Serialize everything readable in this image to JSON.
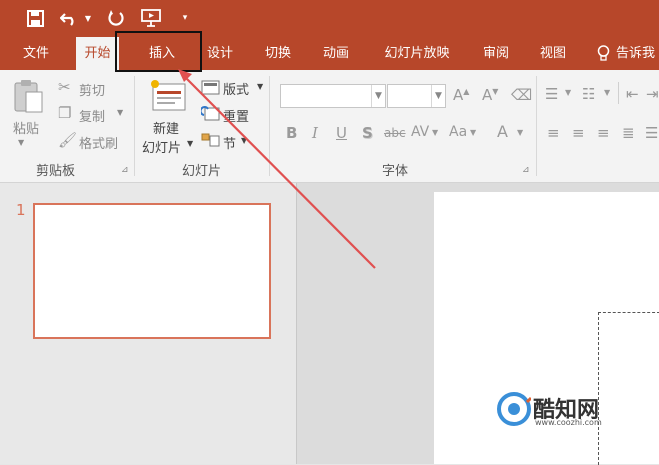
{
  "menu": {
    "tabs": [
      "文件",
      "开始",
      "插入",
      "设计",
      "切换",
      "动画",
      "幻灯片放映",
      "审阅",
      "视图"
    ],
    "tell_me": "告诉我"
  },
  "ribbon": {
    "clipboard": {
      "paste": "粘贴",
      "cut": "剪切",
      "copy": "复制",
      "format_painter": "格式刷",
      "group_label": "剪贴板"
    },
    "slides": {
      "new_slide_line1": "新建",
      "new_slide_line2": "幻灯片",
      "layout": "版式",
      "reset": "重置",
      "section": "节",
      "group_label": "幻灯片"
    },
    "font": {
      "bold": "B",
      "italic": "I",
      "underline": "U",
      "shadow": "S",
      "strikethrough": "abc",
      "spacing": "AV",
      "change_case": "Aa",
      "font_color": "A",
      "group_label": "字体"
    }
  },
  "slides_panel": {
    "slide_number": "1"
  },
  "watermark": {
    "brand": "酷知网",
    "url": "www.coozhi.com"
  },
  "colors": {
    "accent": "#b7472a",
    "highlight_arrow": "#e05050"
  }
}
